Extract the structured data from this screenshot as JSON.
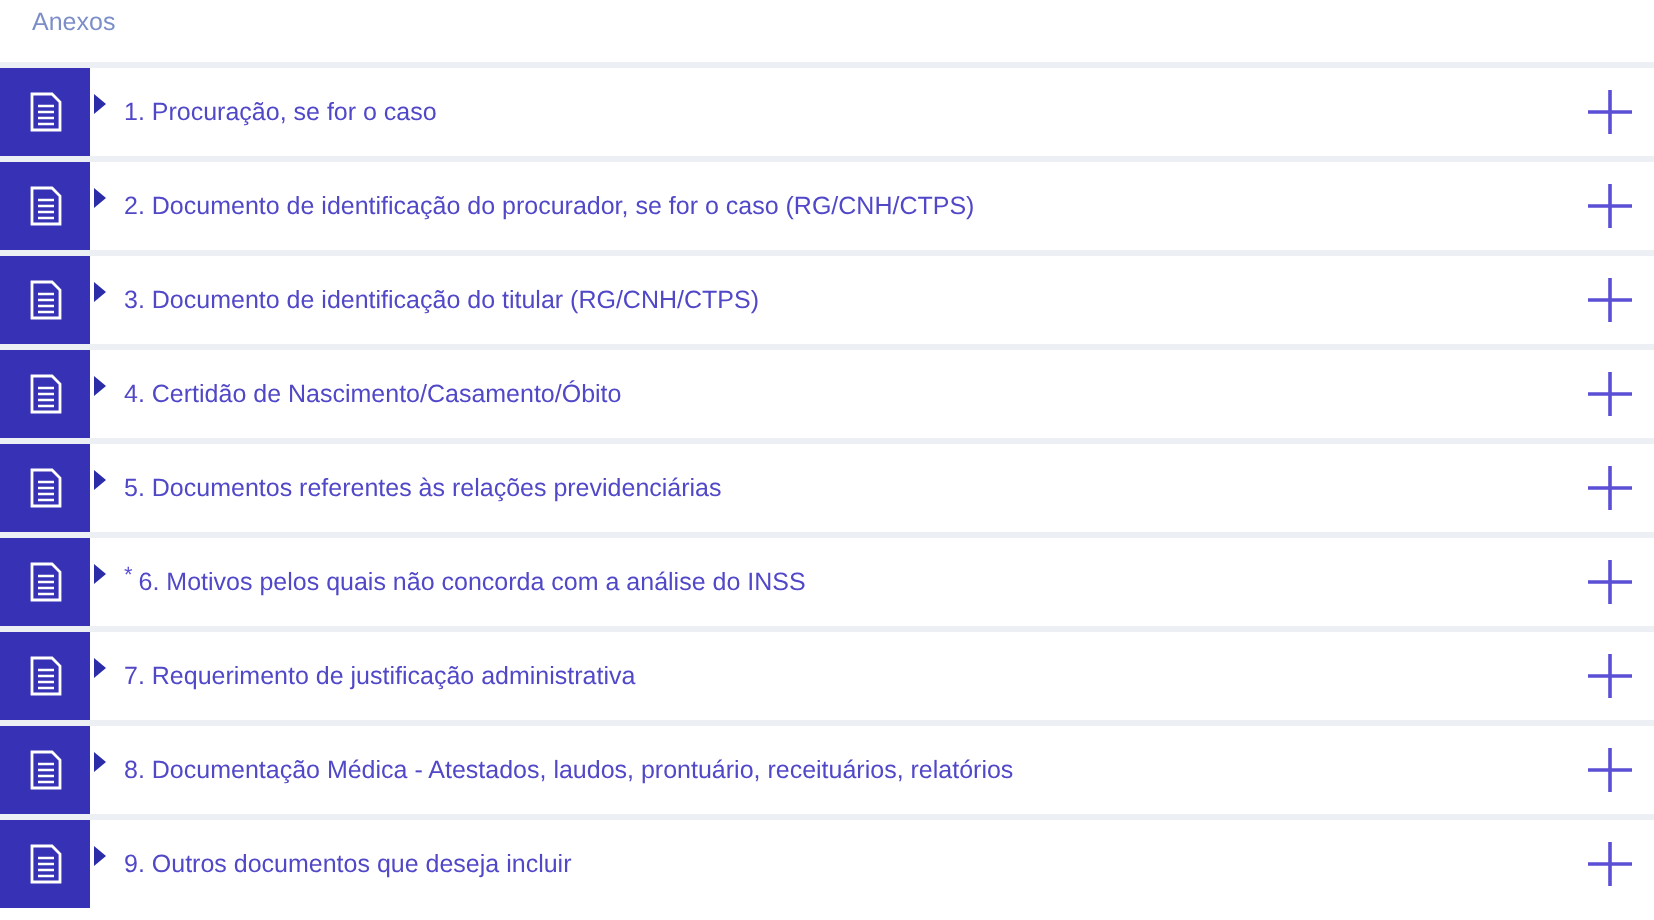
{
  "section_title": "Anexos",
  "attachments": [
    {
      "label": "1. Procuração, se for o caso"
    },
    {
      "label": "2. Documento de identificação do procurador, se for o caso (RG/CNH/CTPS)"
    },
    {
      "label": "3. Documento de identificação do titular (RG/CNH/CTPS)"
    },
    {
      "label": "4. Certidão de Nascimento/Casamento/Óbito"
    },
    {
      "label": "5. Documentos referentes às relações previdenciárias"
    },
    {
      "required_mark": "*",
      "label": "6. Motivos pelos quais não concorda com a análise do INSS"
    },
    {
      "label": "7. Requerimento de justificação administrativa"
    },
    {
      "label": "8. Documentação Médica - Atestados, laudos, prontuário, receituários, relatórios"
    },
    {
      "label": "9. Outros documentos que deseja incluir"
    }
  ]
}
